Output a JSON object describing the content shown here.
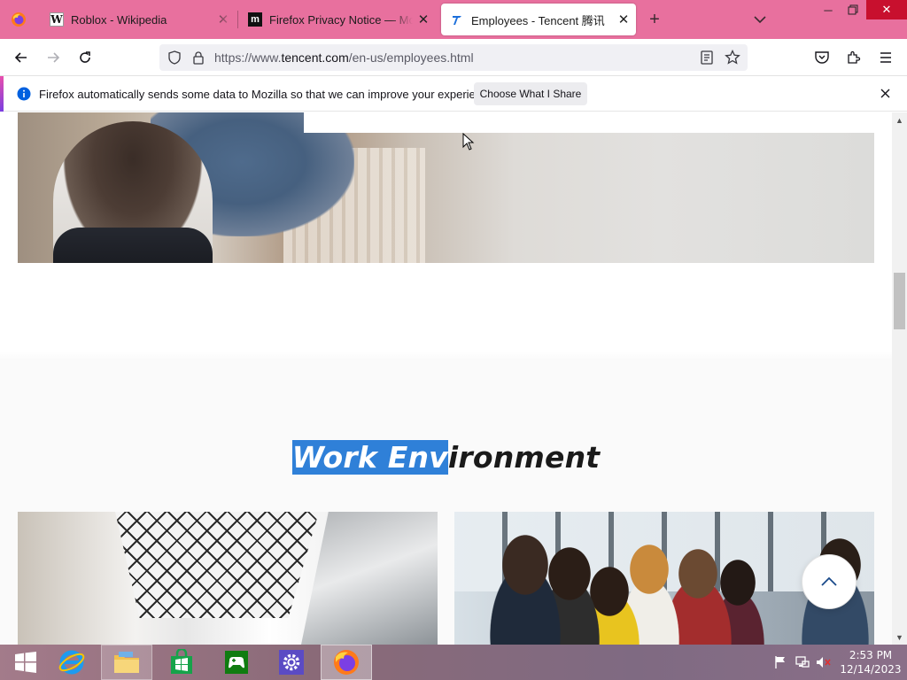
{
  "browser": {
    "tabs": [
      {
        "title": "Roblox - Wikipedia",
        "favicon": "wikipedia-icon",
        "active": false
      },
      {
        "title": "Firefox Privacy Notice — Mozilla",
        "favicon": "mozilla-icon",
        "active": false
      },
      {
        "title": "Employees - Tencent 腾讯",
        "favicon": "tencent-icon",
        "active": true
      }
    ],
    "url": {
      "prefix": "https://www.",
      "domain": "tencent.com",
      "path": "/en-us/employees.html"
    }
  },
  "notification": {
    "message": "Firefox automatically sends some data to Mozilla so that we can improve your experience.",
    "button_label": "Choose What I Share"
  },
  "page": {
    "section_title_selected": "Work Env",
    "section_title_rest": "ironment"
  },
  "taskbar": {
    "apps": [
      "start-icon",
      "internet-explorer-icon",
      "file-explorer-icon",
      "store-icon",
      "xbox-games-icon",
      "settings-icon",
      "firefox-icon"
    ],
    "clock_time": "2:53 PM",
    "clock_date": "12/14/2023"
  },
  "colors": {
    "tab_strip": "#e8709e",
    "selection": "#2f80d8",
    "close_button": "#c8102e"
  }
}
